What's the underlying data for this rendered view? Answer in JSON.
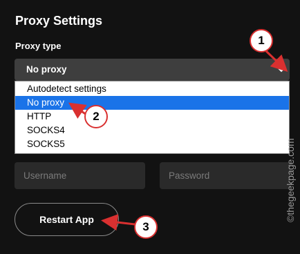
{
  "header": {
    "title": "Proxy Settings"
  },
  "proxy": {
    "label": "Proxy type",
    "selected": "No proxy",
    "options": [
      "Autodetect settings",
      "No proxy",
      "HTTP",
      "SOCKS4",
      "SOCKS5"
    ]
  },
  "auth": {
    "username_placeholder": "Username",
    "password_placeholder": "Password"
  },
  "actions": {
    "restart_label": "Restart App"
  },
  "annotations": {
    "badge1": "1",
    "badge2": "2",
    "badge3": "3"
  },
  "watermark": "©thegeekpage.com",
  "colors": {
    "selected_option": "#1a73e8",
    "annotation_red": "#d93030",
    "background": "#121212"
  }
}
